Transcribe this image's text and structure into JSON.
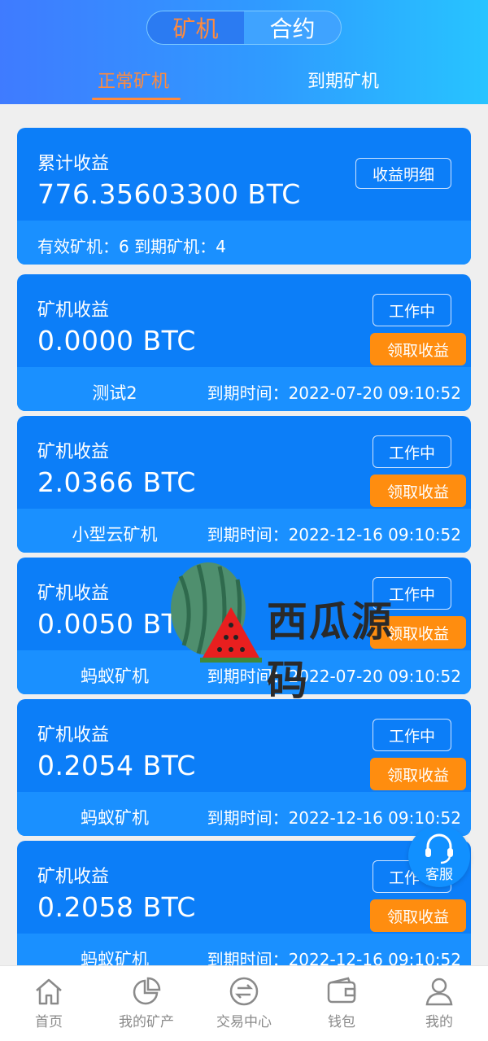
{
  "top_tabs": {
    "miner": "矿机",
    "contract": "合约"
  },
  "sub_tabs": {
    "normal": "正常矿机",
    "expired": "到期矿机"
  },
  "summary": {
    "label": "累计收益",
    "amount": "776.35603300 BTC",
    "detail_button": "收益明细",
    "stats": "有效矿机：6   到期矿机：4"
  },
  "miners": [
    {
      "label": "矿机收益",
      "amount": "0.0000 BTC",
      "status": "工作中",
      "claim": "领取收益",
      "name": "测试2",
      "expire": "到期时间：2022-07-20 09:10:52"
    },
    {
      "label": "矿机收益",
      "amount": "2.0366 BTC",
      "status": "工作中",
      "claim": "领取收益",
      "name": "小型云矿机",
      "expire": "到期时间：2022-12-16 09:10:52"
    },
    {
      "label": "矿机收益",
      "amount": "0.0050 BTC",
      "status": "工作中",
      "claim": "领取收益",
      "name": "蚂蚁矿机",
      "expire": "到期时间：2022-07-20 09:10:52"
    },
    {
      "label": "矿机收益",
      "amount": "0.2054 BTC",
      "status": "工作中",
      "claim": "领取收益",
      "name": "蚂蚁矿机",
      "expire": "到期时间：2022-12-16 09:10:52"
    },
    {
      "label": "矿机收益",
      "amount": "0.2058 BTC",
      "status": "工作中",
      "claim": "领取收益",
      "name": "蚂蚁矿机",
      "expire": "到期时间：2022-12-16 09:10:52"
    }
  ],
  "watermark": {
    "text": "西瓜源码"
  },
  "customer_service": {
    "label": "客服"
  },
  "tabbar": [
    {
      "label": "首页",
      "icon": "home-icon"
    },
    {
      "label": "我的矿产",
      "icon": "pie-chart-icon"
    },
    {
      "label": "交易中心",
      "icon": "exchange-icon"
    },
    {
      "label": "钱包",
      "icon": "wallet-icon"
    },
    {
      "label": "我的",
      "icon": "user-icon"
    }
  ],
  "colors": {
    "primary": "#0c7ef8",
    "accent": "#ff8a3d",
    "claim": "#ff8d0f"
  }
}
